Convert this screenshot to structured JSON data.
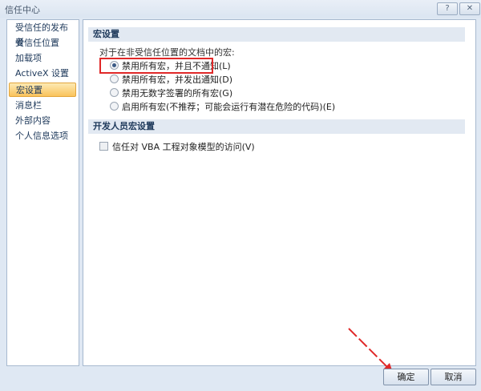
{
  "window": {
    "title": "信任中心",
    "help_icon": "?",
    "close_icon": "✕"
  },
  "sidebar": {
    "items": [
      {
        "label": "受信任的发布者"
      },
      {
        "label": "受信任位置"
      },
      {
        "label": "加载项"
      },
      {
        "label": "ActiveX 设置"
      },
      {
        "label": "宏设置",
        "selected": true
      },
      {
        "label": "消息栏"
      },
      {
        "label": "外部内容"
      },
      {
        "label": "个人信息选项"
      }
    ]
  },
  "main": {
    "macro_section": {
      "title": "宏设置",
      "prompt": "对于在非受信任位置的文档中的宏:",
      "options": [
        {
          "label": "禁用所有宏，并且不通知(L)",
          "selected": true
        },
        {
          "label": "禁用所有宏，并发出通知(D)",
          "selected": false
        },
        {
          "label": "禁用无数字签署的所有宏(G)",
          "selected": false
        },
        {
          "label": "启用所有宏(不推荐；可能会运行有潜在危险的代码)(E)",
          "selected": false
        }
      ]
    },
    "developer_section": {
      "title": "开发人员宏设置",
      "checkbox_label": "信任对 VBA 工程对象模型的访问(V)",
      "checked": false
    }
  },
  "buttons": {
    "ok": "确定",
    "cancel": "取消"
  },
  "colors": {
    "highlight": "#e02828",
    "selected": "#f9c35c"
  }
}
